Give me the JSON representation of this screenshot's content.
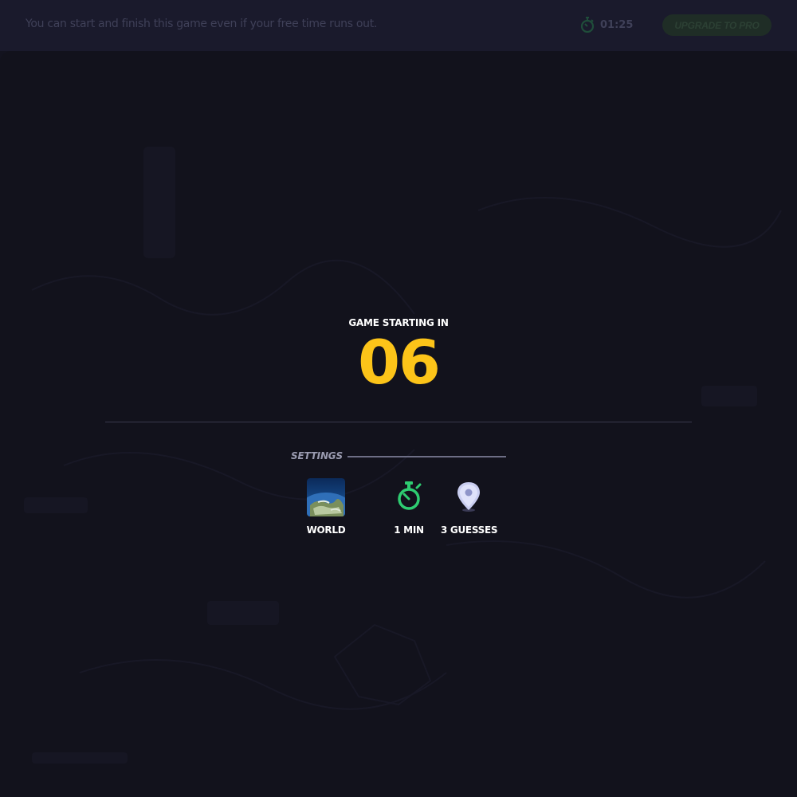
{
  "topbar": {
    "message": "You can start and finish this game even if your free time runs out.",
    "timer": "01:25",
    "upgrade_label": "UPGRADE TO PRO",
    "timer_icon": "stopwatch-icon"
  },
  "game": {
    "starting_label": "GAME STARTING IN",
    "countdown": "06"
  },
  "settings": {
    "label": "SETTINGS",
    "items": [
      {
        "label": "WORLD",
        "icon": "globe-icon"
      },
      {
        "label": "1 MIN",
        "icon": "stopwatch-icon"
      },
      {
        "label": "3 GUESSES",
        "icon": "map-pin-icon"
      }
    ]
  },
  "colors": {
    "accent_yellow": "#fcc419",
    "timer_green": "#2ecc71",
    "background": "#13131f"
  }
}
